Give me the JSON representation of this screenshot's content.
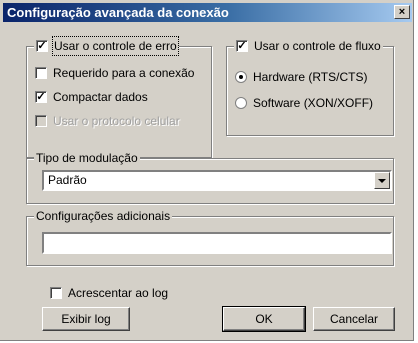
{
  "window": {
    "title": "Configuração avançada da conexão",
    "close_glyph": "×"
  },
  "error_control": {
    "label": "Usar o controle de erro",
    "checked": true,
    "options": [
      {
        "label": "Requerido para a conexão",
        "checked": false,
        "enabled": true
      },
      {
        "label": "Compactar dados",
        "checked": true,
        "enabled": true
      },
      {
        "label": "Usar o protocolo celular",
        "checked": false,
        "enabled": false
      }
    ]
  },
  "flow_control": {
    "label": "Usar o controle de fluxo",
    "checked": true,
    "options": [
      {
        "label": "Hardware (RTS/CTS)",
        "selected": true
      },
      {
        "label": "Software (XON/XOFF)",
        "selected": false
      }
    ]
  },
  "modulation": {
    "label": "Tipo de modulação",
    "value": "Padrão"
  },
  "extra_settings": {
    "label": "Configurações adicionais",
    "value": ""
  },
  "append_log": {
    "label": "Acrescentar ao log",
    "checked": false
  },
  "buttons": {
    "view_log": "Exibir log",
    "ok": "OK",
    "cancel": "Cancelar"
  },
  "check_glyph": "✓"
}
